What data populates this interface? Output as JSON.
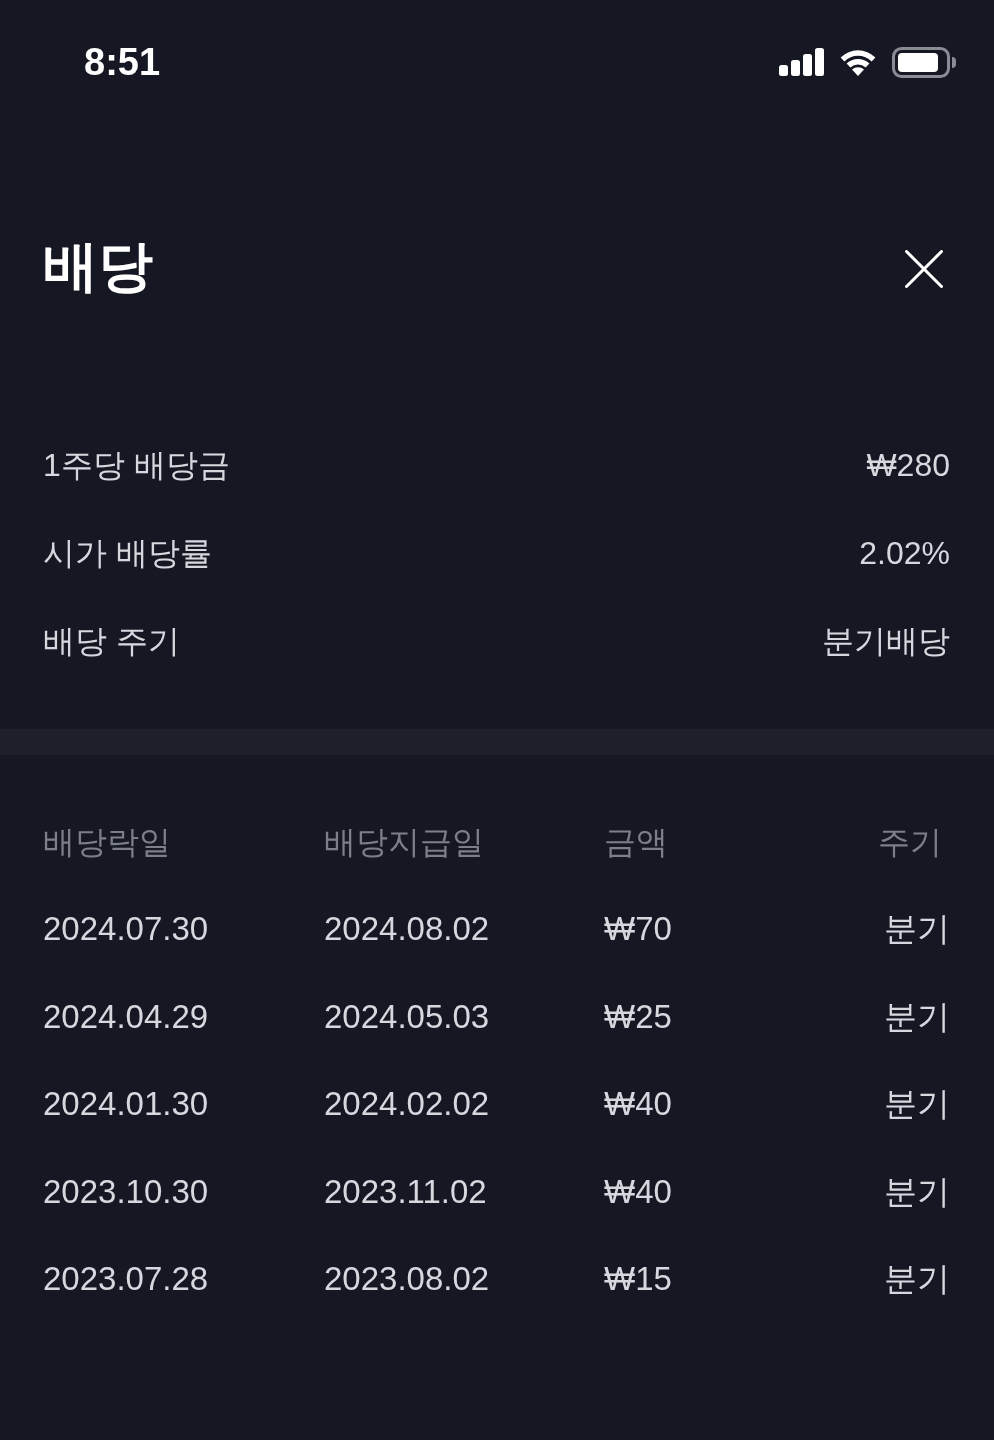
{
  "status_bar": {
    "time": "8:51"
  },
  "header": {
    "title": "배당"
  },
  "summary": [
    {
      "label": "1주당 배당금",
      "value": "₩280"
    },
    {
      "label": "시가 배당률",
      "value": "2.02%"
    },
    {
      "label": "배당 주기",
      "value": "분기배당"
    }
  ],
  "table": {
    "columns": [
      "배당락일",
      "배당지급일",
      "금액",
      "주기"
    ],
    "rows": [
      [
        "2024.07.30",
        "2024.08.02",
        "₩70",
        "분기"
      ],
      [
        "2024.04.29",
        "2024.05.03",
        "₩25",
        "분기"
      ],
      [
        "2024.01.30",
        "2024.02.02",
        "₩40",
        "분기"
      ],
      [
        "2023.10.30",
        "2023.11.02",
        "₩40",
        "분기"
      ],
      [
        "2023.07.28",
        "2023.08.02",
        "₩15",
        "분기"
      ]
    ]
  }
}
